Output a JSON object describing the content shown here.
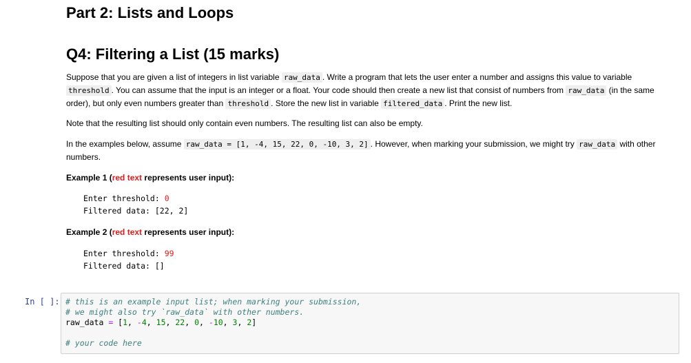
{
  "part_title": "Part 2: Lists and Loops",
  "question_title": "Q4: Filtering a List (15 marks)",
  "p1": {
    "t1": "Suppose that you are given a list of integers in list variable ",
    "c1": "raw_data",
    "t2": ". Write a program that lets the user enter a number and assigns this value to variable ",
    "c2": "threshold",
    "t3": ". You can assume that the input is an integer or a float. Your code should then create a new list that consist of numbers from ",
    "c3": "raw_data",
    "t4": " (in the same order), but only even numbers greater than ",
    "c4": "threshold",
    "t5": ". Store the new list in variable ",
    "c5": "filtered_data",
    "t6": ". Print the new list."
  },
  "p2": "Note that the resulting list should only contain even numbers. The resulting list can also be empty.",
  "p3": {
    "t1": "In the examples below, assume ",
    "c1": "raw_data = [1, -4, 15, 22, 0, -10, 3, 2]",
    "t2": ". However, when marking your submission, we might try ",
    "c2": "raw_data",
    "t3": " with other numbers."
  },
  "example1": {
    "head_a": "Example 1 (",
    "head_red": "red text",
    "head_b": " represents user input):",
    "line1_prompt": "Enter threshold: ",
    "line1_input": "0",
    "line2": "Filtered data: [22, 2]"
  },
  "example2": {
    "head_a": "Example 2 (",
    "head_red": "red text",
    "head_b": " represents user input):",
    "line1_prompt": "Enter threshold: ",
    "line1_input": "99",
    "line2": "Filtered data: []"
  },
  "cell": {
    "prompt": "In [ ]:",
    "comment1": "# this is an example input list; when marking your submission,",
    "comment2": "# we might also try `raw_data` with other numbers.",
    "var": "raw_data ",
    "eq": "=",
    "list_open": " [",
    "n1": "1",
    "sep1": ", ",
    "n2": "-4",
    "sep2": ", ",
    "n3": "15",
    "sep3": ", ",
    "n4": "22",
    "sep4": ", ",
    "n5": "0",
    "sep5": ", ",
    "n6": "-10",
    "sep6": ", ",
    "n7": "3",
    "sep7": ", ",
    "n8": "2",
    "list_close": "]",
    "comment3": "# your code here"
  },
  "colors": {
    "user_input": "#e31a1a",
    "prompt": "#303f9f",
    "comment": "#408080",
    "number": "#008000",
    "operator": "#aa22ff"
  }
}
